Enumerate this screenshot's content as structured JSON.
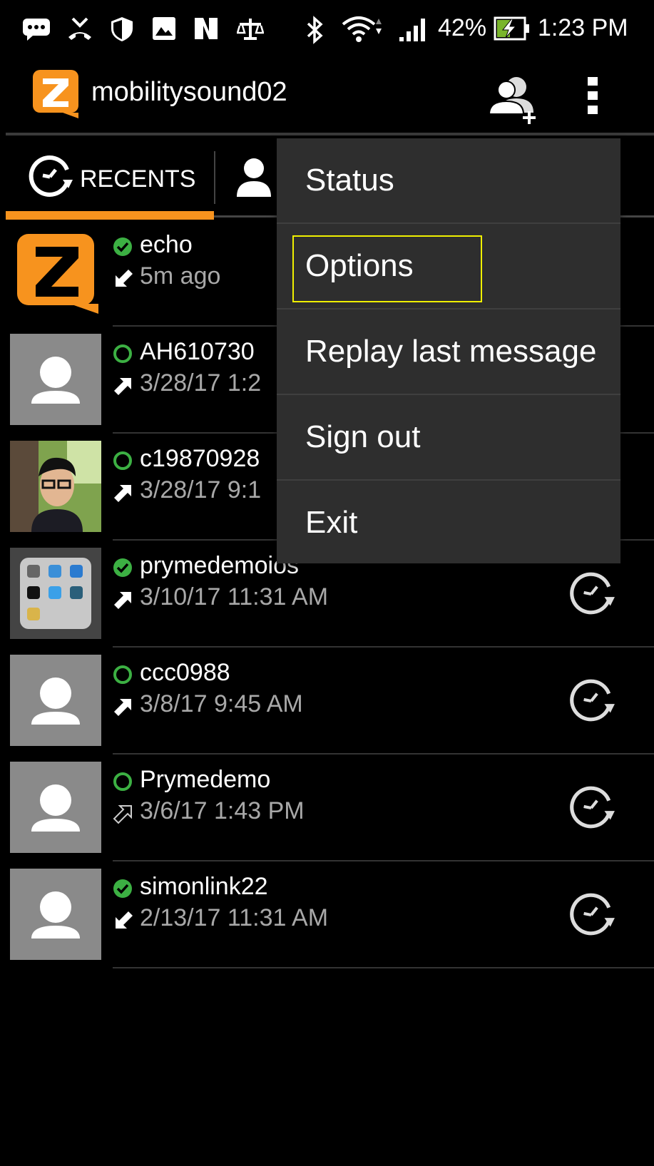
{
  "status_bar": {
    "battery": "42%",
    "time": "1:23 PM",
    "icons": [
      "chat-bubble-icon",
      "missed-call-icon",
      "shield-icon",
      "image-icon",
      "nfc-icon",
      "scale-icon",
      "bluetooth-icon",
      "wifi-icon",
      "signal-icon",
      "battery-charging-icon"
    ]
  },
  "app_bar": {
    "title": "mobilitysound02",
    "icons": [
      "zello-logo-icon",
      "add-contact-icon",
      "overflow-menu-icon"
    ]
  },
  "tabs": [
    {
      "label": "RECENTS",
      "icon": "history-icon",
      "selected": true
    },
    {
      "label": "",
      "icon": "person-icon",
      "selected": false
    }
  ],
  "recents": [
    {
      "name": "echo",
      "time": "5m ago",
      "status": "online",
      "direction": "incoming",
      "avatar": "zello-logo"
    },
    {
      "name": "AH610730",
      "time": "3/28/17 1:2",
      "status": "offline",
      "direction": "outgoing",
      "avatar": "default"
    },
    {
      "name": "c19870928",
      "time": "3/28/17 9:1",
      "status": "offline",
      "direction": "outgoing",
      "avatar": "photo"
    },
    {
      "name": "prymedemoios",
      "time": "3/10/17 11:31 AM",
      "status": "online",
      "direction": "outgoing",
      "avatar": "folder-screenshot"
    },
    {
      "name": "ccc0988",
      "time": "3/8/17 9:45 AM",
      "status": "offline",
      "direction": "outgoing",
      "avatar": "default"
    },
    {
      "name": "Prymedemo",
      "time": "3/6/17 1:43 PM",
      "status": "offline",
      "direction": "outgoing-missed",
      "avatar": "default"
    },
    {
      "name": "simonlink22",
      "time": "2/13/17 11:31 AM",
      "status": "online",
      "direction": "incoming",
      "avatar": "default"
    }
  ],
  "menu": {
    "items": [
      {
        "label": "Status"
      },
      {
        "label": "Options",
        "highlighted": true
      },
      {
        "label": "Replay last message"
      },
      {
        "label": "Sign out"
      },
      {
        "label": "Exit"
      }
    ]
  },
  "colors": {
    "accent": "#f7931e",
    "online": "#3cb043",
    "highlight": "#f0f000",
    "menu_bg": "#2e2e2e"
  }
}
